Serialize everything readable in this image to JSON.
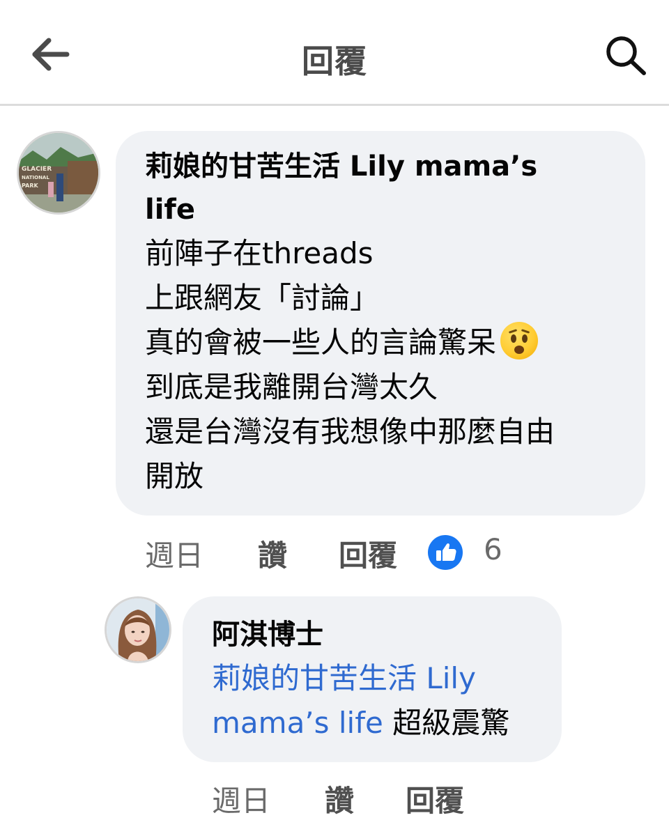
{
  "header": {
    "title": "回覆",
    "back_icon": "back-arrow-icon",
    "search_icon": "search-icon"
  },
  "comment": {
    "author": "莉娘的甘苦生活 Lily mama’s life",
    "author_lines": [
      "莉娘的甘苦生活 Lily mama’s",
      "life"
    ],
    "body_lines": [
      "前陣子在threads",
      "上跟網友「討論」",
      "真的會被一些人的言論驚呆",
      "到底是我離開台灣太久",
      "還是台灣沒有我想像中那麼自由",
      "開放"
    ],
    "emoji": "anguished-face-emoji",
    "time": "週日",
    "like_label": "讚",
    "reply_label": "回覆",
    "reaction_count": "6",
    "avatar_text": [
      "GLACIER",
      "NATIONAL",
      "PARK"
    ]
  },
  "reply": {
    "author": "阿淇博士",
    "mention_lines": [
      "莉娘的甘苦生活 Lily",
      "mama’s life"
    ],
    "text": "超級震驚",
    "time": "週日",
    "like_label": "讚",
    "reply_label": "回覆"
  },
  "colors": {
    "bubble": "#f0f2f5",
    "mention": "#2f6ad0",
    "like_blue": "#1877f2",
    "meta_gray": "#6a6a6a"
  }
}
